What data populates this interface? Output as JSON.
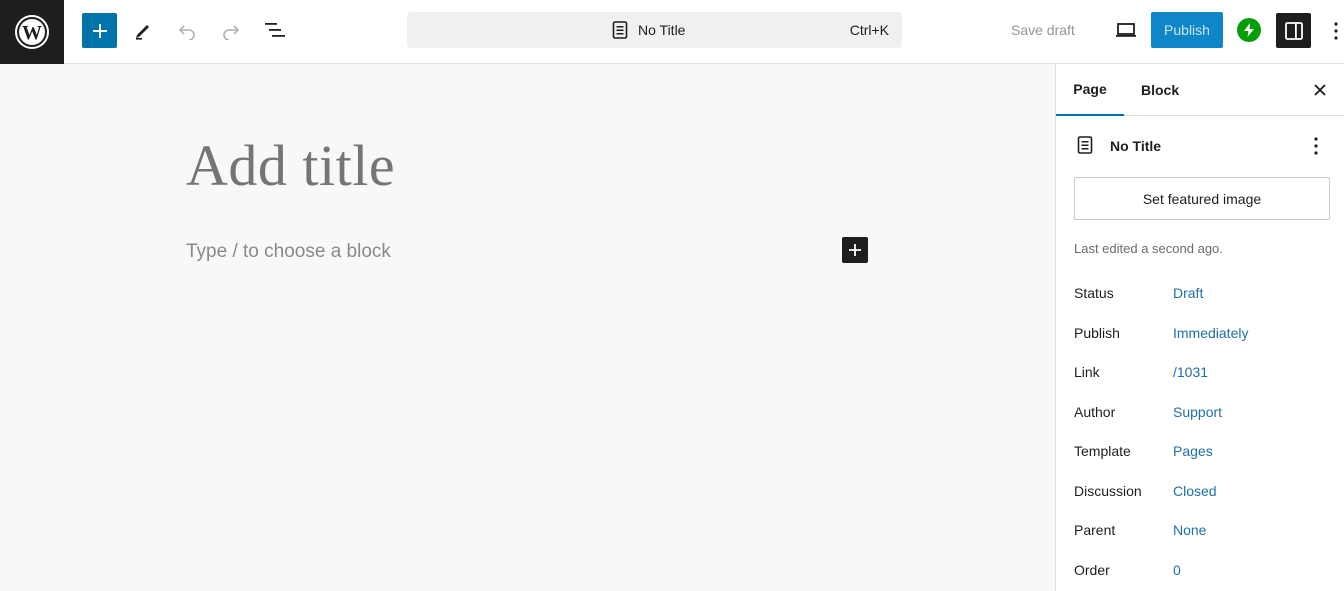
{
  "toolbar": {
    "logo_icon": "wordpress-logo",
    "add_block_icon": "plus-icon",
    "tools_icon": "pencil-icon",
    "undo_icon": "undo-icon",
    "redo_icon": "redo-icon",
    "list_view_icon": "list-view-icon",
    "command_bar": {
      "icon": "document-icon",
      "title": "No Title",
      "shortcut": "Ctrl+K"
    },
    "save_draft_label": "Save draft",
    "preview_icon": "laptop-icon",
    "publish_label": "Publish",
    "jetpack_icon": "jetpack-icon",
    "settings_icon": "sidebar-toggle-icon",
    "options_icon": "more-vertical-icon",
    "accent_color": "#0073aa"
  },
  "editor": {
    "title_placeholder": "Add title",
    "block_placeholder": "Type / to choose a block",
    "inserter_icon": "plus-icon"
  },
  "sidebar": {
    "tabs": [
      {
        "label": "Page",
        "active": true
      },
      {
        "label": "Block",
        "active": false
      }
    ],
    "close_icon": "close-icon",
    "document": {
      "icon": "document-icon",
      "title": "No Title",
      "menu_icon": "more-vertical-icon"
    },
    "featured_image_label": "Set featured image",
    "last_edited": "Last edited a second ago.",
    "meta": [
      {
        "label": "Status",
        "value": "Draft"
      },
      {
        "label": "Publish",
        "value": "Immediately"
      },
      {
        "label": "Link",
        "value": "/1031"
      },
      {
        "label": "Author",
        "value": "Support"
      },
      {
        "label": "Template",
        "value": "Pages"
      },
      {
        "label": "Discussion",
        "value": "Closed"
      },
      {
        "label": "Parent",
        "value": "None"
      },
      {
        "label": "Order",
        "value": "0"
      }
    ],
    "link_color": "#1f6fa8"
  }
}
